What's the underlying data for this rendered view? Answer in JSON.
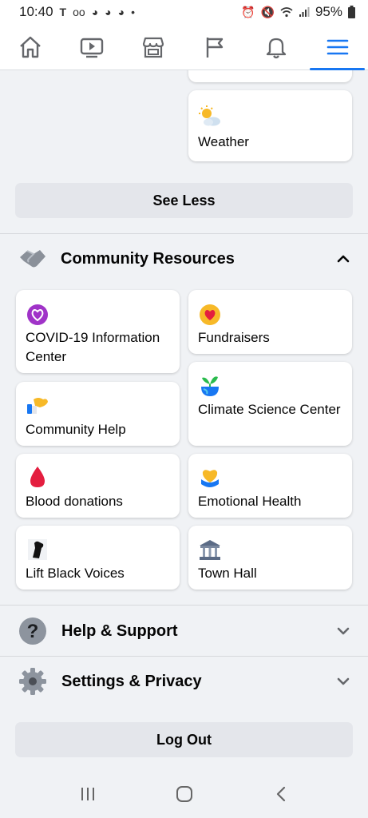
{
  "status_bar": {
    "time": "10:40",
    "battery": "95%",
    "left_icons": [
      "tmobile-icon",
      "voicemail-icon",
      "app-icon",
      "app-icon",
      "app-icon",
      "dot-icon"
    ],
    "right_icons": [
      "alarm-icon",
      "mute-icon",
      "wifi-icon",
      "signal-icon",
      "battery-icon"
    ]
  },
  "nav": {
    "tabs": [
      {
        "icon": "home-icon",
        "active": false
      },
      {
        "icon": "video-icon",
        "active": false
      },
      {
        "icon": "marketplace-icon",
        "active": false
      },
      {
        "icon": "pages-flag-icon",
        "active": false
      },
      {
        "icon": "notifications-bell-icon",
        "active": false
      },
      {
        "icon": "menu-icon",
        "active": true
      }
    ],
    "accent": "#1877f2"
  },
  "top_cards": {
    "weather": "Weather"
  },
  "see_less": "See Less",
  "community": {
    "title": "Community Resources",
    "cards": {
      "covid": "COVID-19 Information Center",
      "fundraisers": "Fundraisers",
      "community_help": "Community Help",
      "climate": "Climate Science Center",
      "blood": "Blood donations",
      "emotional": "Emotional Health",
      "lift": "Lift Black Voices",
      "townhall": "Town Hall"
    }
  },
  "help": {
    "title": "Help & Support"
  },
  "settings": {
    "title": "Settings & Privacy"
  },
  "logout": "Log Out"
}
